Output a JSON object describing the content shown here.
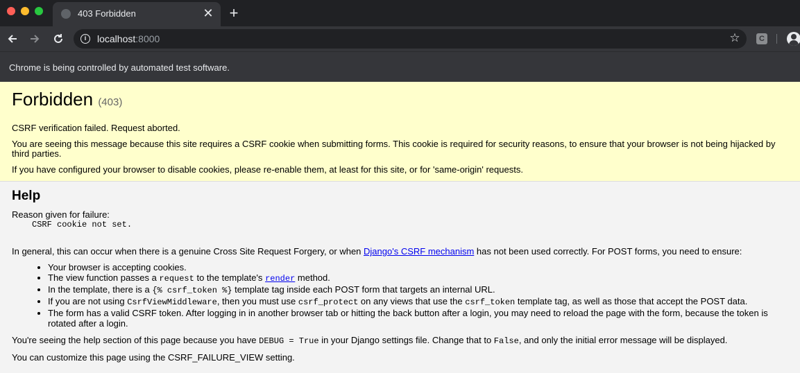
{
  "browser": {
    "tab_title": "403 Forbidden",
    "tab_close": "✕",
    "new_tab": "+",
    "url_host": "localhost",
    "url_port": ":8000",
    "extension_label": "C",
    "automation_notice": "Chrome is being controlled by automated test software."
  },
  "page": {
    "title": "Forbidden",
    "code": "(403)",
    "summary": [
      "CSRF verification failed. Request aborted.",
      "You are seeing this message because this site requires a CSRF cookie when submitting forms. This cookie is required for security reasons, to ensure that your browser is not being hijacked by third parties.",
      "If you have configured your browser to disable cookies, please re-enable them, at least for this site, or for 'same-origin' requests."
    ],
    "help": {
      "heading": "Help",
      "reason_label": "Reason given for failure:",
      "reason_value": "CSRF cookie not set.",
      "general_pre": "In general, this can occur when there is a genuine Cross Site Request Forgery, or when ",
      "general_link": "Django's CSRF mechanism",
      "general_post": " has not been used correctly. For POST forms, you need to ensure:",
      "bullets": {
        "b1": "Your browser is accepting cookies.",
        "b2_pre": "The view function passes a ",
        "b2_code": "request",
        "b2_mid": " to the template's ",
        "b2_link": "render",
        "b2_post": " method.",
        "b3_pre": "In the template, there is a ",
        "b3_code": "{% csrf_token %}",
        "b3_post": " template tag inside each POST form that targets an internal URL.",
        "b4_pre": "If you are not using ",
        "b4_code1": "CsrfViewMiddleware",
        "b4_mid1": ", then you must use ",
        "b4_code2": "csrf_protect",
        "b4_mid2": " on any views that use the ",
        "b4_code3": "csrf_token",
        "b4_post": " template tag, as well as those that accept the POST data.",
        "b5": "The form has a valid CSRF token. After logging in in another browser tab or hitting the back button after a login, you may need to reload the page with the form, because the token is rotated after a login."
      },
      "debug_pre": "You're seeing the help section of this page because you have ",
      "debug_code1": "DEBUG = True",
      "debug_mid": " in your Django settings file. Change that to ",
      "debug_code2": "False",
      "debug_post": ", and only the initial error message will be displayed.",
      "customize": "You can customize this page using the CSRF_FAILURE_VIEW setting."
    }
  },
  "icons": [
    "globe-icon",
    "close-icon",
    "plus-icon",
    "back-arrow-icon",
    "forward-arrow-icon",
    "reload-icon",
    "info-icon",
    "star-icon",
    "extension-icon",
    "profile-icon"
  ],
  "colors": {
    "summary_bg": "#ffffcc",
    "help_bg": "#f3f3f3",
    "link": "#0000ee",
    "chrome_dark": "#202124",
    "chrome_toolbar": "#35363a"
  }
}
